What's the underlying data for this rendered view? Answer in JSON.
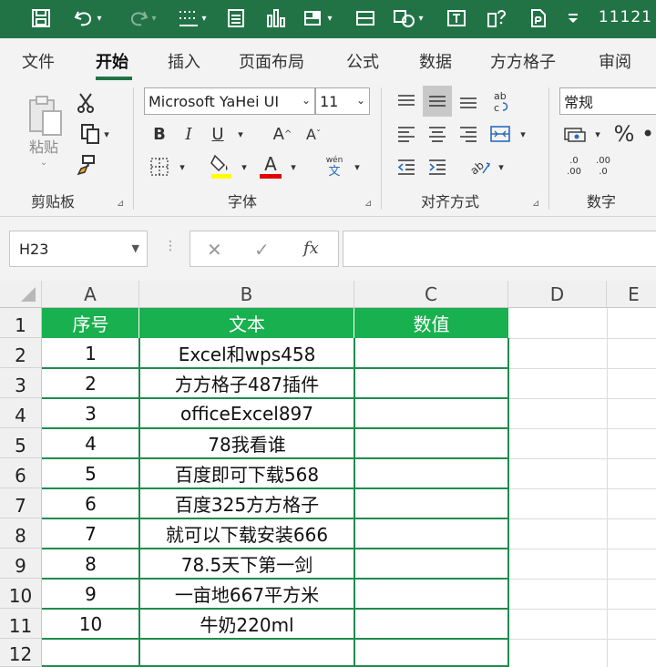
{
  "titlebar": {
    "title": "11121",
    "bg": "#217346"
  },
  "tabs": [
    "文件",
    "开始",
    "插入",
    "页面布局",
    "公式",
    "数据",
    "方方格子",
    "审阅"
  ],
  "active_tab": "开始",
  "ribbon": {
    "clipboard": {
      "paste_label": "粘贴",
      "group_label": "剪贴板"
    },
    "font": {
      "font_name": "Microsoft YaHei UI",
      "font_size": "11",
      "bold": "B",
      "italic": "I",
      "underline": "U",
      "grow_font": "A",
      "shrink_font": "A",
      "phonetic": "wén",
      "phonetic_sub": "文",
      "font_color_letter": "A",
      "group_label": "字体"
    },
    "alignment": {
      "group_label": "对齐方式"
    },
    "number": {
      "format": "常规",
      "percent": "%",
      "increase_decimal_top": ".0",
      "increase_decimal_bottom": ".00",
      "decrease_decimal_top": ".00",
      "decrease_decimal_bottom": ".0",
      "group_label": "数字"
    }
  },
  "formula_bar": {
    "name_box": "H23",
    "cancel": "✕",
    "enter": "✓",
    "fx": "fx",
    "value": ""
  },
  "sheet": {
    "columns": [
      "A",
      "B",
      "C",
      "D",
      "E"
    ],
    "row_numbers": [
      "1",
      "2",
      "3",
      "4",
      "5",
      "6",
      "7",
      "8",
      "9",
      "10",
      "11",
      "12"
    ],
    "headers": [
      "序号",
      "文本",
      "数值"
    ],
    "rows": [
      [
        "1",
        "Excel和wps458",
        ""
      ],
      [
        "2",
        "方方格子487插件",
        ""
      ],
      [
        "3",
        "officeExcel897",
        ""
      ],
      [
        "4",
        "78我看谁",
        ""
      ],
      [
        "5",
        "百度即可下载568",
        ""
      ],
      [
        "6",
        "百度325方方格子",
        ""
      ],
      [
        "7",
        "就可以下载安装666",
        ""
      ],
      [
        "8",
        "78.5天下第一剑",
        ""
      ],
      [
        "9",
        "一亩地667平方米",
        ""
      ],
      [
        "10",
        "牛奶220ml",
        ""
      ],
      [
        "",
        "",
        ""
      ]
    ],
    "header_fill": "#19b04f",
    "border_color": "#1e8c4c"
  }
}
